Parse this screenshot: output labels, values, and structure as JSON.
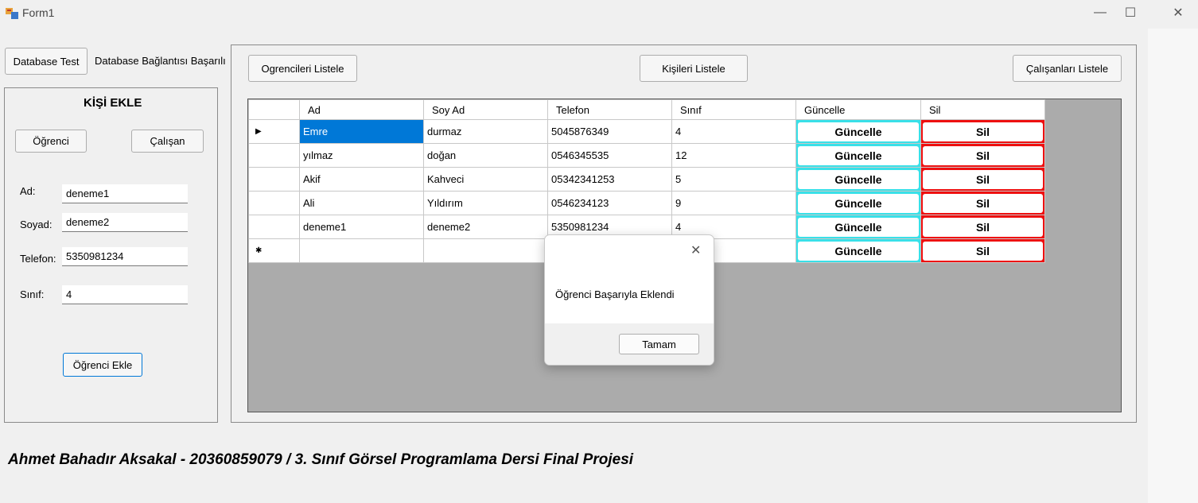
{
  "window": {
    "title": "Form1",
    "controls": {
      "minimize": "—",
      "maximize": "☐",
      "close": "✕"
    }
  },
  "db": {
    "test_button": "Database Test",
    "status": "Database Bağlantısı Başarılı"
  },
  "add_panel": {
    "title": "KİŞİ EKLE",
    "student_button": "Öğrenci",
    "employee_button": "Çalışan",
    "fields": {
      "ad": {
        "label": "Ad:",
        "value": "deneme1"
      },
      "soyad": {
        "label": "Soyad:",
        "value": "deneme2"
      },
      "telefon": {
        "label": "Telefon:",
        "value": "5350981234"
      },
      "sinif": {
        "label": "Sınıf:",
        "value": "4"
      }
    },
    "submit_button": "Öğrenci Ekle"
  },
  "list_buttons": {
    "students": "Ogrencileri Listele",
    "people": "Kişileri Listele",
    "employees": "Çalışanları Listele"
  },
  "grid": {
    "columns": [
      "Ad",
      "Soy Ad",
      "Telefon",
      "Sınıf",
      "Güncelle",
      "Sil"
    ],
    "rows": [
      {
        "ad": "Emre",
        "soyad": "durmaz",
        "telefon": "5045876349",
        "sinif": "4"
      },
      {
        "ad": "yılmaz",
        "soyad": "doğan",
        "telefon": "0546345535",
        "sinif": "12"
      },
      {
        "ad": "Akif",
        "soyad": "Kahveci",
        "telefon": "05342341253",
        "sinif": "5"
      },
      {
        "ad": "Ali",
        "soyad": "Yıldırım",
        "telefon": "0546234123",
        "sinif": "9"
      },
      {
        "ad": "deneme1",
        "soyad": "deneme2",
        "telefon": "5350981234",
        "sinif": "4"
      }
    ],
    "update_label": "Güncelle",
    "delete_label": "Sil",
    "current_row_marker": "▶",
    "new_row_marker": "✱",
    "update_color": "#39e0e8",
    "delete_color": "#ee1010",
    "selection_color": "#0078d7"
  },
  "dialog": {
    "message": "Öğrenci Başarıyla Eklendi",
    "ok_button": "Tamam",
    "close": "✕"
  },
  "footer": "Ahmet Bahadır Aksakal - 20360859079 / 3. Sınıf Görsel Programlama Dersi Final Projesi"
}
